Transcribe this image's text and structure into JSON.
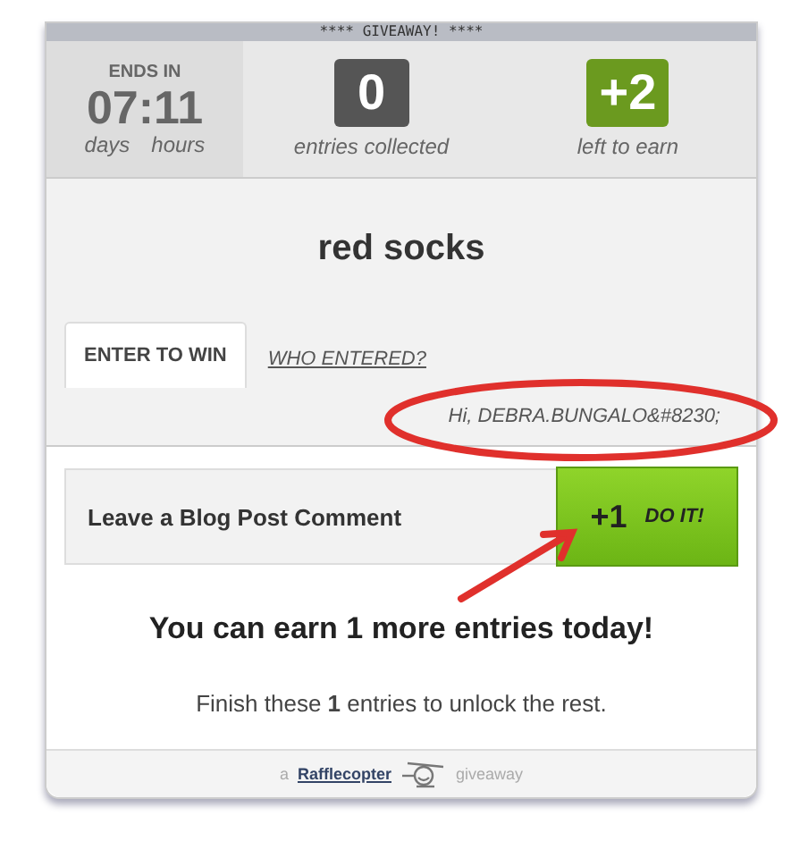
{
  "banner": "**** GIVEAWAY! ****",
  "countdown": {
    "label": "ENDS IN",
    "days": "07",
    "separator": ":",
    "hours": "11",
    "days_label": "days",
    "hours_label": "hours"
  },
  "stats": [
    {
      "value": "0",
      "label": "entries collected",
      "color": "#555555"
    },
    {
      "value": "+2",
      "label": "left to earn",
      "color": "#6b9a1f"
    }
  ],
  "prize": "red socks",
  "tabs": [
    {
      "label": "ENTER TO WIN",
      "selected": true
    },
    {
      "label": "WHO ENTERED?",
      "selected": false
    }
  ],
  "user_line": "Hi, DEBRA.BUNGALO&#8230;",
  "entries": [
    {
      "label": "Leave a Blog Post Comment",
      "points": "+1",
      "action": "DO IT!"
    }
  ],
  "earn_message": "You can earn **1** more entries today!",
  "finish_message": "Finish these **1** entries to unlock the rest.",
  "footer": {
    "prefix": "a",
    "link": "Rafflecopter",
    "suffix": "giveaway"
  }
}
